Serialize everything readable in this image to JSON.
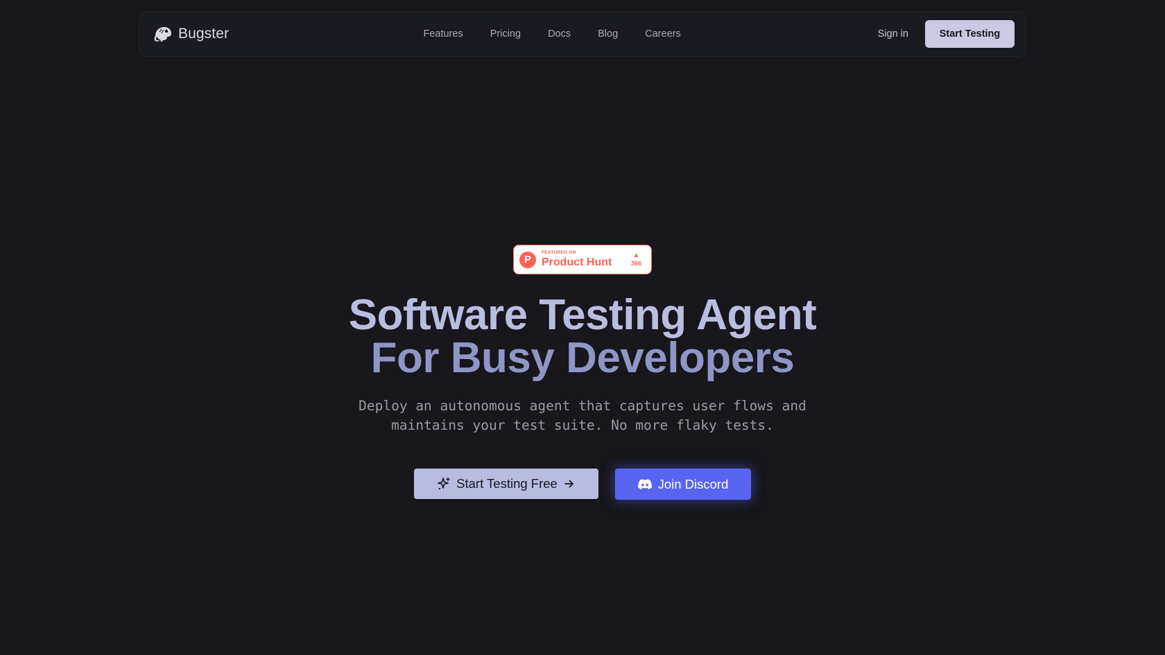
{
  "brand": {
    "name": "Bugster",
    "logo_icon": "chameleon-icon"
  },
  "nav": {
    "links": [
      "Features",
      "Pricing",
      "Docs",
      "Blog",
      "Careers"
    ],
    "sign_in": "Sign in",
    "cta": "Start Testing"
  },
  "product_hunt": {
    "featured_label": "FEATURED ON",
    "name": "Product Hunt",
    "logo_letter": "P",
    "votes": "366",
    "color": "#ff6154"
  },
  "hero": {
    "headline_line1": "Software Testing Agent",
    "headline_line2": "For Busy Developers",
    "subtitle_line1": "Deploy an autonomous agent that captures user flows and",
    "subtitle_line2": "maintains your test suite. No more flaky tests.",
    "primary_cta": "Start Testing Free",
    "primary_cta_icons": [
      "sparkle-icon",
      "arrow-right-icon"
    ],
    "discord_cta": "Join Discord",
    "discord_icon": "discord-icon"
  },
  "colors": {
    "background": "#17171c",
    "accent": "#b8bce0",
    "discord": "#5865f2"
  }
}
